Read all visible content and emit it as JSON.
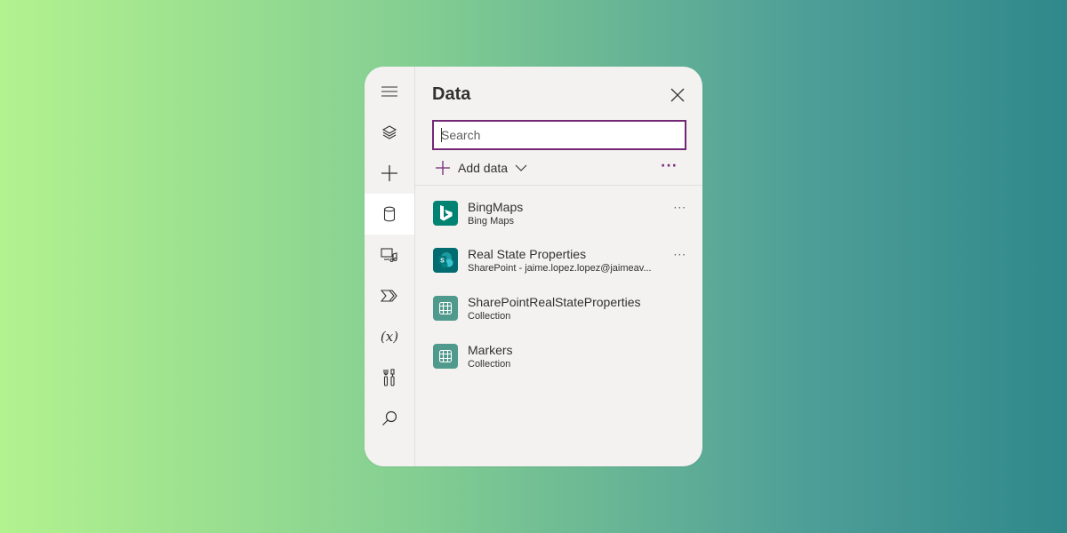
{
  "panel": {
    "title": "Data",
    "search": {
      "placeholder": "Search",
      "value": ""
    },
    "add_data_label": "Add data",
    "more_label": "···"
  },
  "rail": {
    "items": [
      {
        "icon": "hamburger-icon"
      },
      {
        "icon": "layers-icon"
      },
      {
        "icon": "plus-icon"
      },
      {
        "icon": "database-icon",
        "active": true
      },
      {
        "icon": "media-icon"
      },
      {
        "icon": "power-automate-icon"
      },
      {
        "icon": "variables-icon",
        "label": "(x)"
      },
      {
        "icon": "tools-icon"
      },
      {
        "icon": "search-icon"
      }
    ]
  },
  "data_sources": [
    {
      "name": "BingMaps",
      "subtitle": "Bing Maps",
      "icon": "bing-icon",
      "icon_color": "#008373",
      "has_more": true,
      "more_label": "···"
    },
    {
      "name": "Real State Properties",
      "subtitle": "SharePoint - jaime.lopez.lopez@jaimeav...",
      "icon": "sharepoint-icon",
      "icon_color": "#036c70",
      "has_more": true,
      "more_label": "···"
    },
    {
      "name": "SharePointRealStateProperties",
      "subtitle": "Collection",
      "icon": "table-icon",
      "icon_color": "#4f9a8c",
      "has_more": false
    },
    {
      "name": "Markers",
      "subtitle": "Collection",
      "icon": "table-icon",
      "icon_color": "#4f9a8c",
      "has_more": false
    }
  ],
  "colors": {
    "accent": "#742774",
    "panel_bg": "#f3f2f1"
  }
}
